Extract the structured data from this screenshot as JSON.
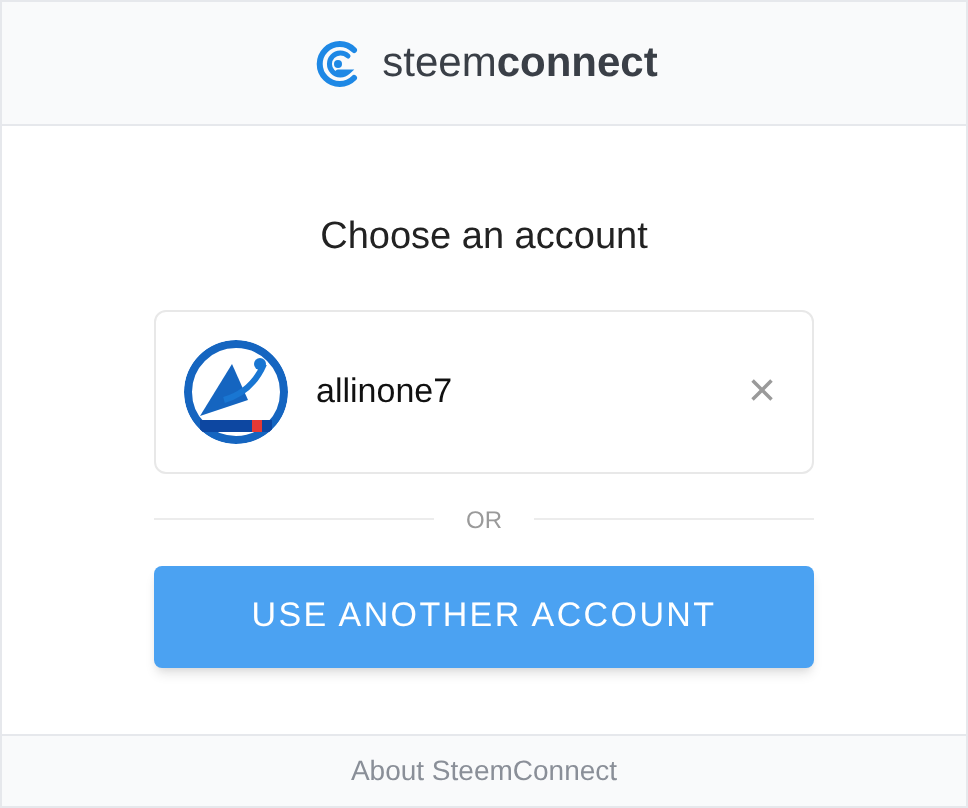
{
  "header": {
    "brand": "steem**connect**"
  },
  "title": "Choose an account",
  "accounts": [
    {
      "username": "allinone7",
      "remove": "×"
    }
  ],
  "divider": "OR",
  "primary_button": "USE ANOTHER ACCOUNT",
  "footer": {
    "link": "About SteemConnect"
  }
}
